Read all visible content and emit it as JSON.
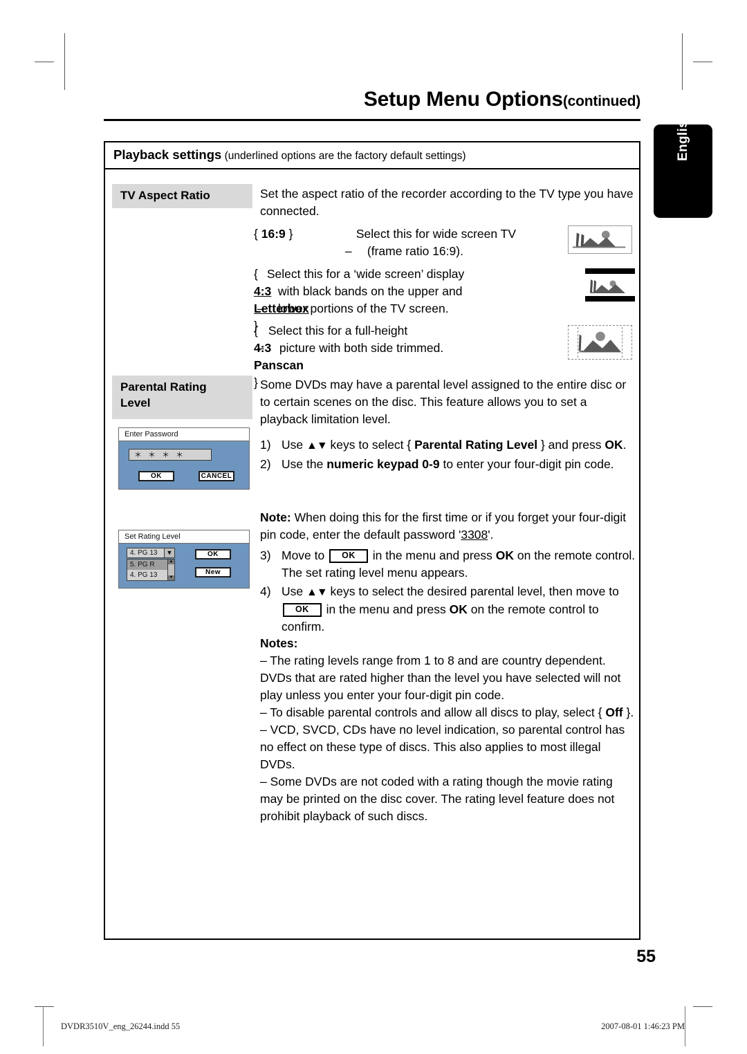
{
  "header": {
    "title_main": "Setup Menu Options",
    "title_suffix": "(continued)"
  },
  "language_tab": {
    "label": "English"
  },
  "section": {
    "heading_bold": "Playback settings",
    "heading_note": " (underlined options are the factory default settings)"
  },
  "tv_aspect": {
    "label": "TV Aspect Ratio",
    "intro": "Set the aspect ratio of the recorder according to the TV type you have connected.",
    "options": [
      {
        "open_brace": "{",
        "key": "16:9",
        "close_brace": "}",
        "dash": "–",
        "desc_line1": "Select this for wide  screen TV",
        "desc_line2": "(frame ratio 16:9).",
        "underlined": false,
        "thumb": "widescreen-thumbnail"
      },
      {
        "open_brace": "{",
        "key": "4:3 Letterbox",
        "close_brace": "}",
        "dash": "–",
        "desc_line1": "Select this for a ‘wide screen’ display",
        "desc_line2": "with black bands on the upper and",
        "desc_line3": "lower portions of the TV screen.",
        "underlined": true,
        "thumb": "letterbox-thumbnail"
      },
      {
        "open_brace": "{",
        "key": "4:3 Panscan",
        "close_brace": "}",
        "dash": "–",
        "desc_line1": "Select this for a full-height",
        "desc_line2": "picture with both side trimmed.",
        "underlined": false,
        "thumb": "panscan-thumbnail"
      }
    ]
  },
  "parental": {
    "label_line1": "Parental Rating",
    "label_line2": "Level",
    "intro": "Some DVDs may have a parental level assigned to the entire disc or to certain scenes on the disc. This feature allows you to set a playback limitation level.",
    "steps": [
      {
        "num": "1)",
        "p1": "Use ",
        "arrows": "▲▼",
        "p2": " keys to select { ",
        "bold1": "Parental Rating Level",
        "p3": " } and press ",
        "bold2": "OK",
        "p4": "."
      },
      {
        "num": "2)",
        "p1": "Use the ",
        "bold1": "numeric keypad 0-9",
        "p2": " to enter your four-digit pin code."
      },
      {
        "num": "3)",
        "p1": "Move to ",
        "key1": "OK",
        "p2": " in the menu and press ",
        "bold1": "OK",
        "p3": " on the remote control.  The set rating level menu appears."
      },
      {
        "num": "4)",
        "p1": "Use ",
        "arrows": "▲▼",
        "p2": " keys to select the desired parental level, then move to ",
        "key1": "OK",
        "p3": " in the menu and press ",
        "bold1": "OK",
        "p4": " on the remote control to confirm."
      }
    ],
    "note": {
      "label": "Note:",
      "p1": "  When doing this for the first time or if you forget your four-digit pin code, enter the default password '",
      "password": "3308",
      "p2": "'."
    },
    "notes_heading": "Notes:",
    "notes": [
      {
        "dash": "–",
        "p1": " The rating levels range from 1 to 8 and are country dependent. DVDs that are rated higher than the level you have selected will not play unless you enter your four-digit pin code."
      },
      {
        "dash": "–",
        "p1": " To disable parental controls and allow all discs to play, select { ",
        "bold1": "Off",
        "p2": " }."
      },
      {
        "dash": "–",
        "p1": " VCD, SVCD, CDs have no level indication, so parental control has no effect on these type of discs. This also applies to most illegal DVDs."
      },
      {
        "dash": "–",
        "p1": " Some DVDs are not coded with a rating though the movie rating may be printed on the disc cover. The rating level feature does not prohibit playback of such discs."
      }
    ]
  },
  "password_dialog": {
    "title": "Enter Password",
    "field_value": "＊ ＊ ＊ ＊",
    "ok_label": "OK",
    "cancel_label": "CANCEL"
  },
  "rating_dialog": {
    "title": "Set Rating Level",
    "selected_value": "4.  PG 13",
    "dropdown_arrow": "▼",
    "list_items": [
      "5.  PG R",
      "4.  PG 13"
    ],
    "ok_label": "OK",
    "new_label": "New",
    "scroll_up": "▲",
    "scroll_down": "▼"
  },
  "page_number": "55",
  "footer": {
    "file": "DVDR3510V_eng_26244.indd   55",
    "date": "2007-08-01   1:46:23 PM"
  },
  "colors": {
    "dialog_blue": "#6e95bd",
    "label_gray": "#d9d9d9",
    "tab_black": "#000000"
  }
}
